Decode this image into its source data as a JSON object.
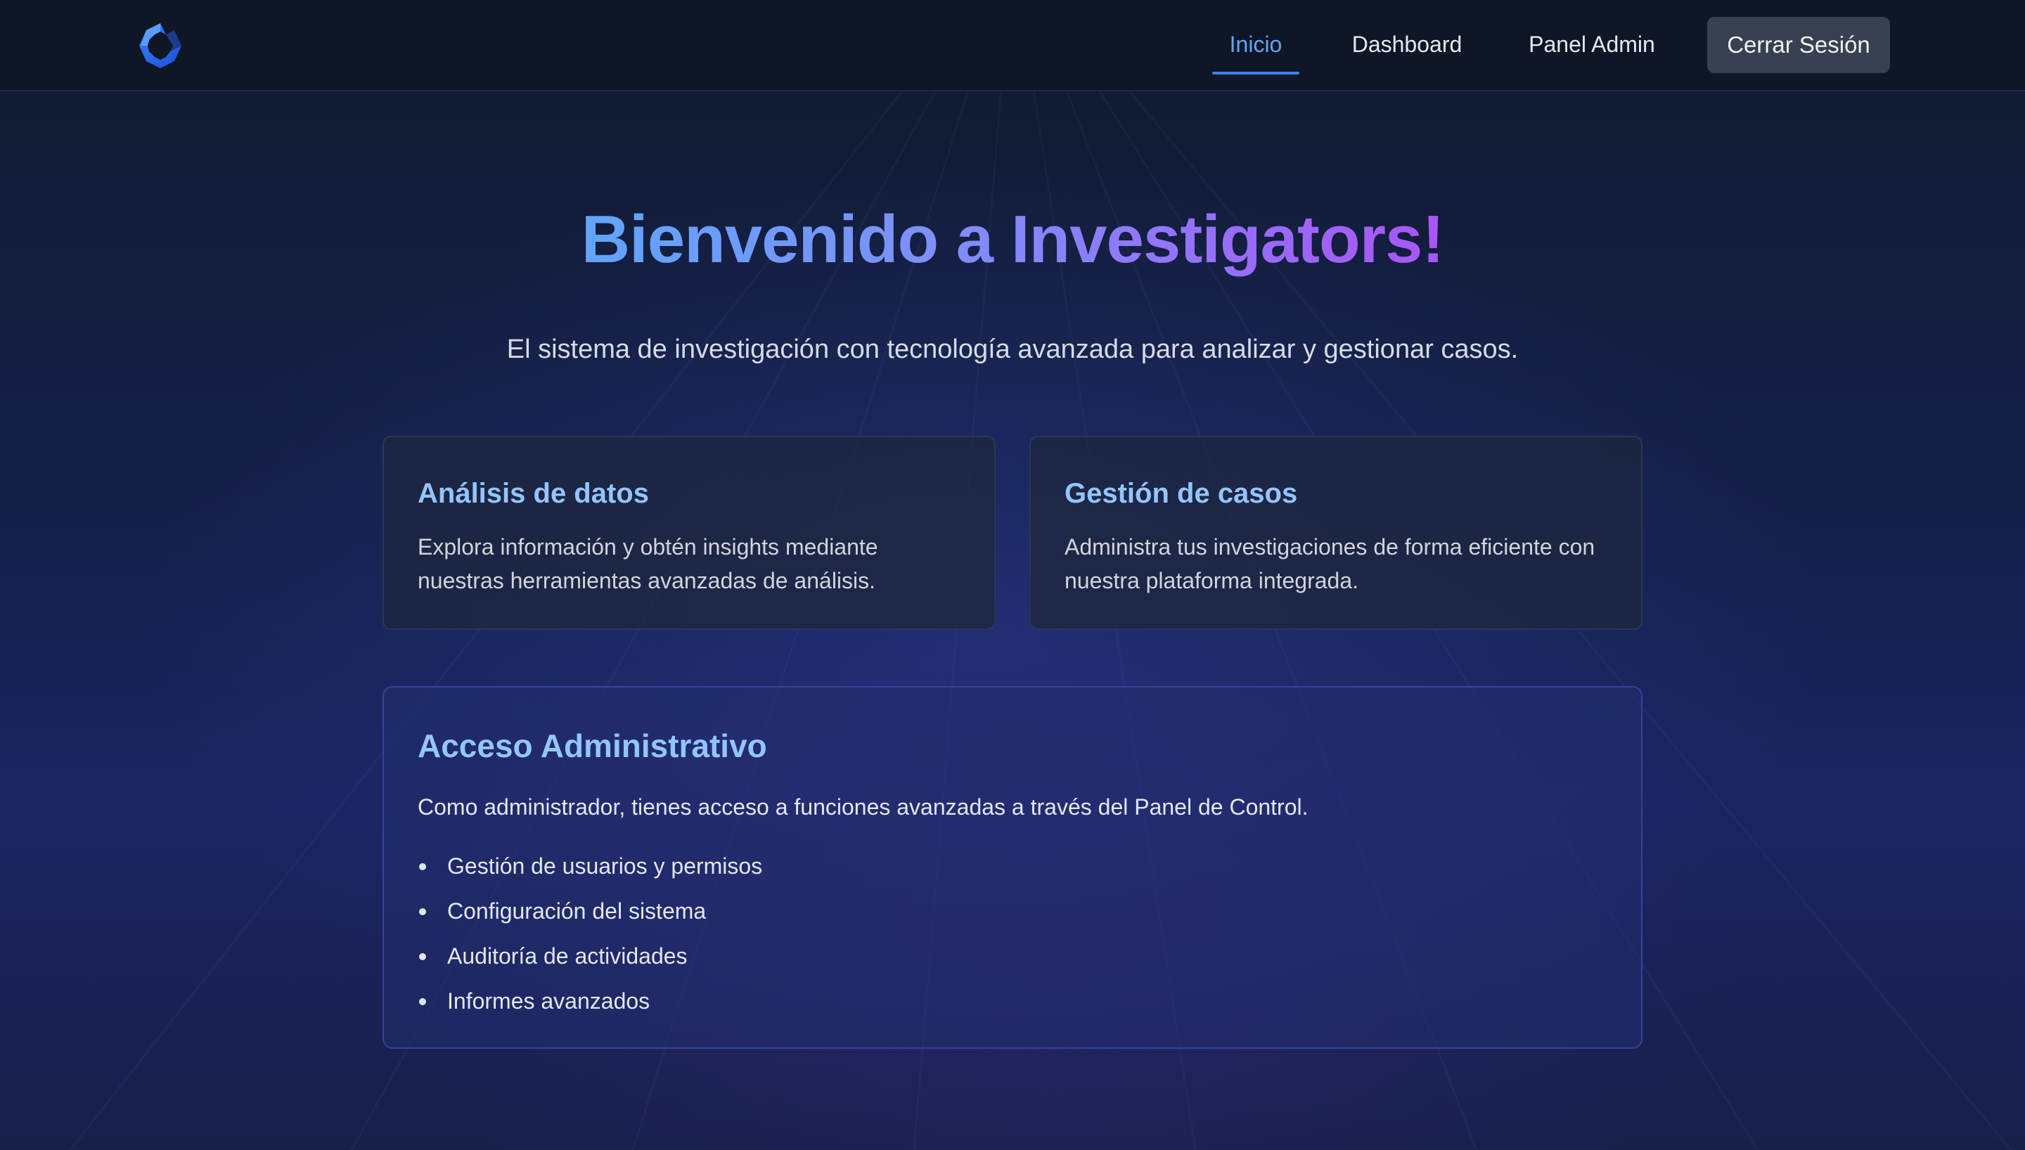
{
  "nav": {
    "logo": "app-logo-icon",
    "links": [
      {
        "label": "Inicio",
        "active": true
      },
      {
        "label": "Dashboard",
        "active": false
      },
      {
        "label": "Panel Admin",
        "active": false
      }
    ],
    "logout_label": "Cerrar Sesión"
  },
  "hero": {
    "title": "Bienvenido a Investigators!",
    "subtitle": "El sistema de investigación con tecnología avanzada para analizar y gestionar casos."
  },
  "features": [
    {
      "title": "Análisis de datos",
      "text": "Explora información y obtén insights mediante nuestras herramientas avanzadas de análisis."
    },
    {
      "title": "Gestión de casos",
      "text": "Administra tus investigaciones de forma eficiente con nuestra plataforma integrada."
    }
  ],
  "admin": {
    "title": "Acceso Administrativo",
    "description": "Como administrador, tienes acceso a funciones avanzadas a través del Panel de Control.",
    "items": [
      "Gestión de usuarios y permisos",
      "Configuración del sistema",
      "Auditoría de actividades",
      "Informes avanzados"
    ]
  },
  "colors": {
    "accent": "#3b82f6",
    "active_link": "#60a5fa",
    "card_title": "#93c5fd",
    "gradient_start": "#60a5fa",
    "gradient_end": "#a855f7",
    "header_bg": "#0f1626",
    "logout_bg": "#374151"
  }
}
